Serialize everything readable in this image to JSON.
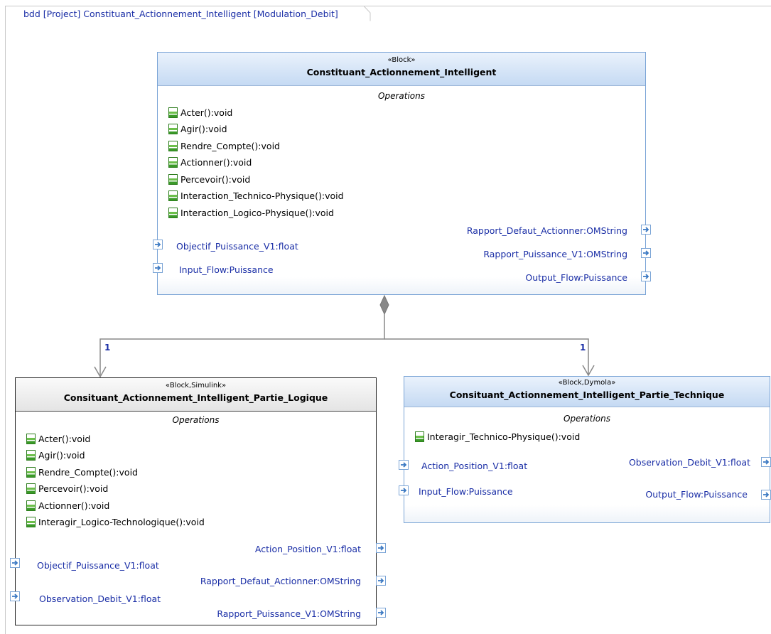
{
  "diagram": {
    "frame_label": "bdd [Project] Constituant_Actionnement_Intelligent [Modulation_Debit]",
    "compartment_title": "Operations",
    "multiplicity_left": "1",
    "multiplicity_right": "1",
    "main_block": {
      "stereotype": "«Block»",
      "name": "Constituant_Actionnement_Intelligent",
      "operations": [
        "Acter():void",
        "Agir():void",
        "Rendre_Compte():void",
        "Actionner():void",
        "Percevoir():void",
        "Interaction_Technico-Physique():void",
        "Interaction_Logico-Physique():void"
      ],
      "ports_left": [
        "Objectif_Puissance_V1:float",
        "Input_Flow:Puissance"
      ],
      "ports_right": [
        "Rapport_Defaut_Actionner:OMString",
        "Rapport_Puissance_V1:OMString",
        "Output_Flow:Puissance"
      ]
    },
    "logic_block": {
      "stereotype": "«Block,Simulink»",
      "name": "Consituant_Actionnement_Intelligent_Partie_Logique",
      "operations": [
        "Acter():void",
        "Agir():void",
        "Rendre_Compte():void",
        "Percevoir():void",
        "Actionner():void",
        "Interagir_Logico-Technologique():void"
      ],
      "ports_left": [
        "Objectif_Puissance_V1:float",
        "Observation_Debit_V1:float"
      ],
      "ports_right": [
        "Action_Position_V1:float",
        "Rapport_Defaut_Actionner:OMString",
        "Rapport_Puissance_V1:OMString"
      ]
    },
    "tech_block": {
      "stereotype": "«Block,Dymola»",
      "name": "Consituant_Actionnement_Intelligent_Partie_Technique",
      "operations": [
        "Interagir_Technico-Physique():void"
      ],
      "ports_left": [
        "Action_Position_V1:float",
        "Input_Flow:Puissance"
      ],
      "ports_right": [
        "Observation_Debit_V1:float",
        "Output_Flow:Puissance"
      ]
    }
  }
}
